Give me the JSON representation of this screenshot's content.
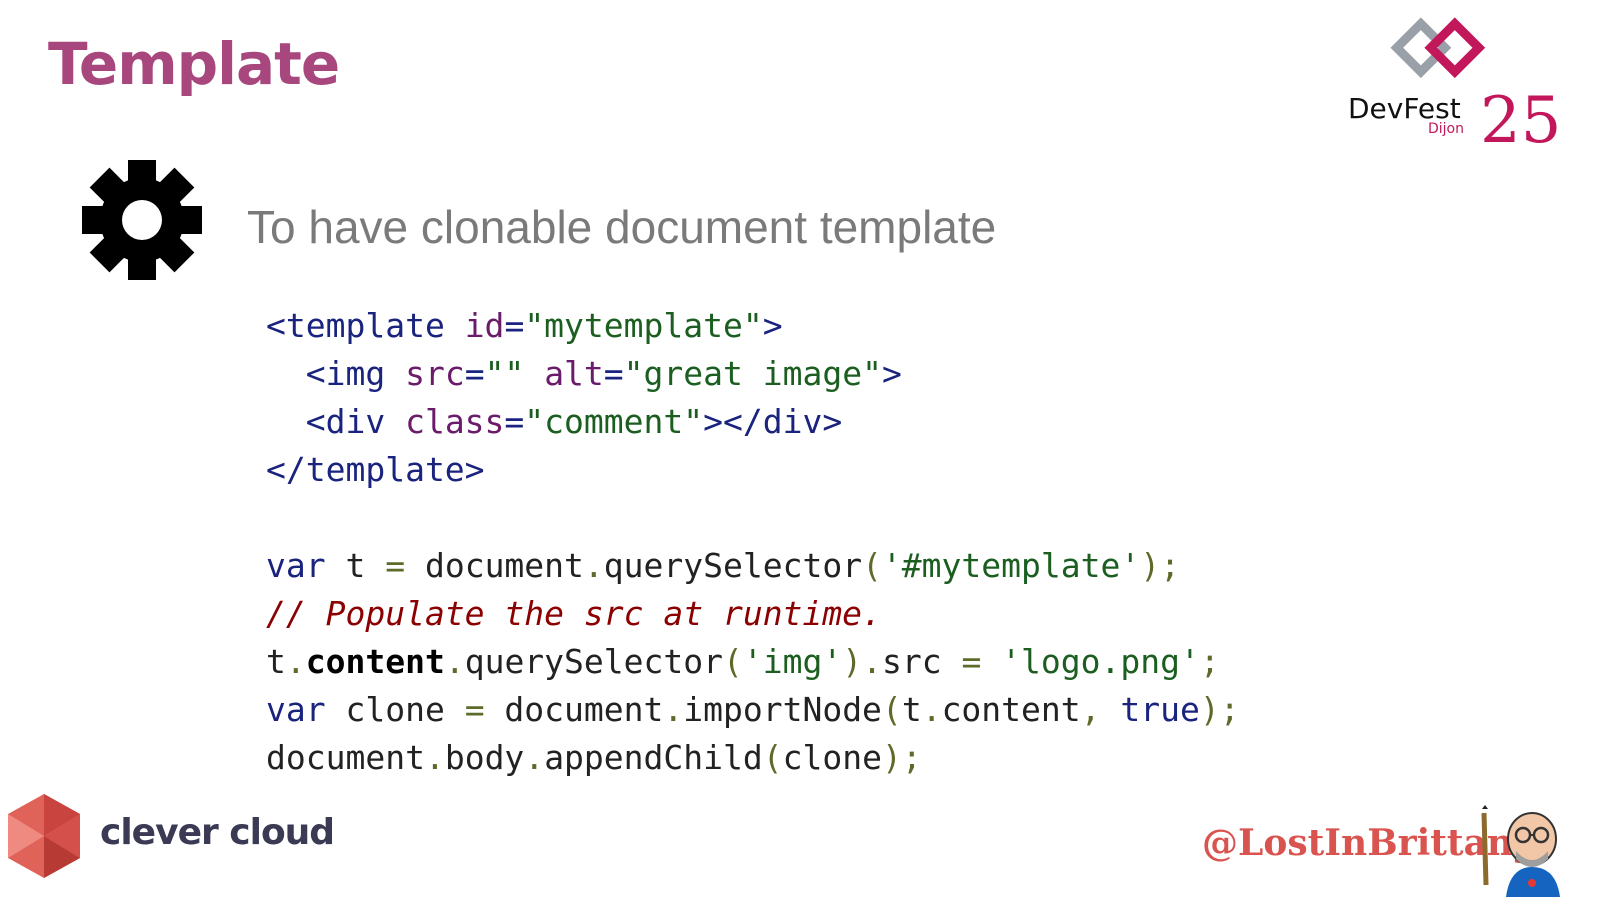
{
  "slide": {
    "title": "Template",
    "subtitle": "To have clonable document template"
  },
  "branding": {
    "event_name": "DevFest",
    "event_city": "Dijon",
    "event_year": "25",
    "company": "clever cloud",
    "author_handle": "@LostInBrittany",
    "accent_color": "#a8477e",
    "icon": "gear-icon"
  },
  "code": {
    "l1": {
      "a": "<template ",
      "b": "id",
      "c": "=",
      "d": "\"mytemplate\"",
      "e": ">"
    },
    "l2": {
      "a": "  <img ",
      "b": "src",
      "c": "=",
      "d": "\"\"",
      "e": " ",
      "f": "alt",
      "g": "=",
      "h": "\"great image\"",
      "i": ">"
    },
    "l3": {
      "a": "  <div ",
      "b": "class",
      "c": "=",
      "d": "\"comment\"",
      "e": "></div>"
    },
    "l4": {
      "a": "</template>"
    },
    "l6": {
      "a": "var",
      "b": " t ",
      "c": "=",
      "d": " document",
      "e": ".",
      "f": "querySelector",
      "g": "(",
      "h": "'#mytemplate'",
      "i": ");"
    },
    "l7": {
      "a": "// Populate the src at runtime."
    },
    "l8": {
      "a": "t",
      "b": ".",
      "c": "content",
      "d": ".",
      "e": "querySelector",
      "f": "(",
      "g": "'img'",
      "h": ").",
      "i": "src ",
      "j": "=",
      "k": " ",
      "l": "'logo.png'",
      "m": ";"
    },
    "l9": {
      "a": "var",
      "b": " clone ",
      "c": "=",
      "d": " document",
      "e": ".",
      "f": "importNode",
      "g": "(",
      "h": "t",
      "i": ".",
      "j": "content",
      "k": ", ",
      "l": "true",
      "m": ");"
    },
    "l10": {
      "a": "document",
      "b": ".",
      "c": "body",
      "d": ".",
      "e": "appendChild",
      "f": "(",
      "g": "clone",
      "h": ");"
    }
  }
}
